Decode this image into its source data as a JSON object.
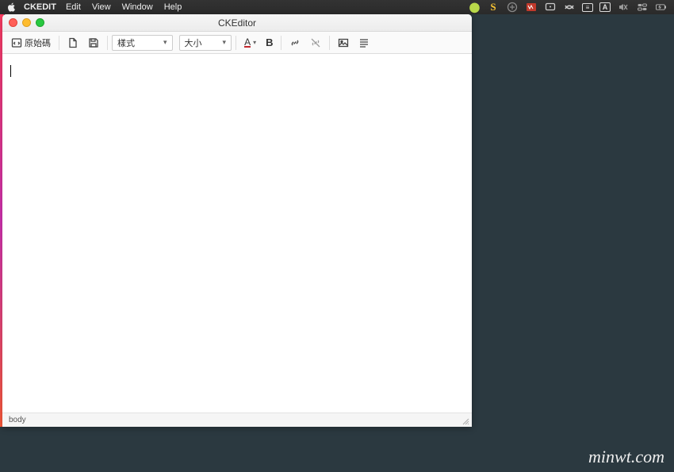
{
  "menubar": {
    "appname": "CKEDIT",
    "items": [
      "Edit",
      "View",
      "Window",
      "Help"
    ]
  },
  "window": {
    "title": "CKEditor"
  },
  "toolbar": {
    "source_label": "原始碼",
    "style_select": "樣式",
    "size_select": "大小",
    "font_color_glyph": "A",
    "bold_glyph": "B"
  },
  "status": {
    "path": "body"
  },
  "watermark": "minwt.com"
}
